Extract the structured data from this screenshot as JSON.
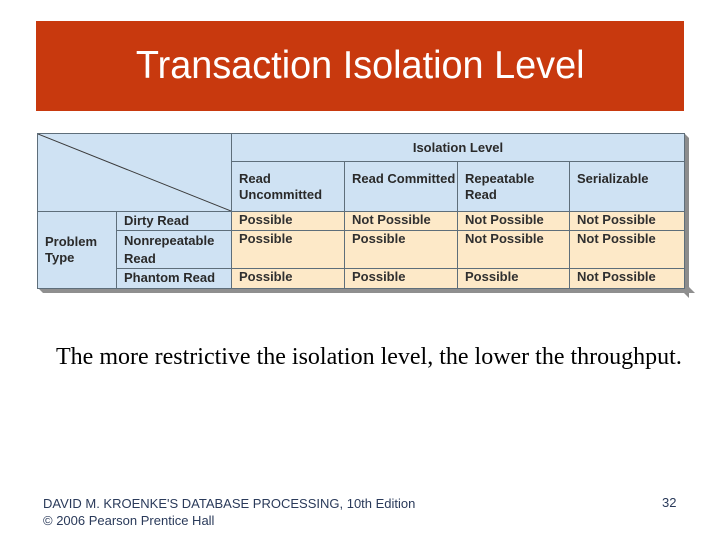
{
  "slide": {
    "title": "Transaction Isolation Level",
    "body_text": "The more restrictive the isolation level, the lower the throughput.",
    "footer_line1": "DAVID M. KROENKE'S DATABASE PROCESSING, 10th Edition",
    "footer_line2": "© 2006 Pearson Prentice Hall",
    "page_number": "32"
  },
  "table": {
    "group_header": "Isolation Level",
    "row_group_label": "Problem Type",
    "columns": [
      "Read Uncommitted",
      "Read Committed",
      "Repeatable Read",
      "Serializable"
    ],
    "rows": [
      {
        "problem": "Dirty Read",
        "values": [
          "Possible",
          "Not Possible",
          "Not Possible",
          "Not Possible"
        ]
      },
      {
        "problem": "Nonrepeatable Read",
        "values": [
          "Possible",
          "Possible",
          "Not Possible",
          "Not Possible"
        ]
      },
      {
        "problem": "Phantom Read",
        "values": [
          "Possible",
          "Possible",
          "Possible",
          "Not Possible"
        ]
      }
    ],
    "colors": {
      "header_bg": "#cfe2f3",
      "cell_bg": "#fde9c8",
      "title_bg": "#c8390e"
    }
  }
}
